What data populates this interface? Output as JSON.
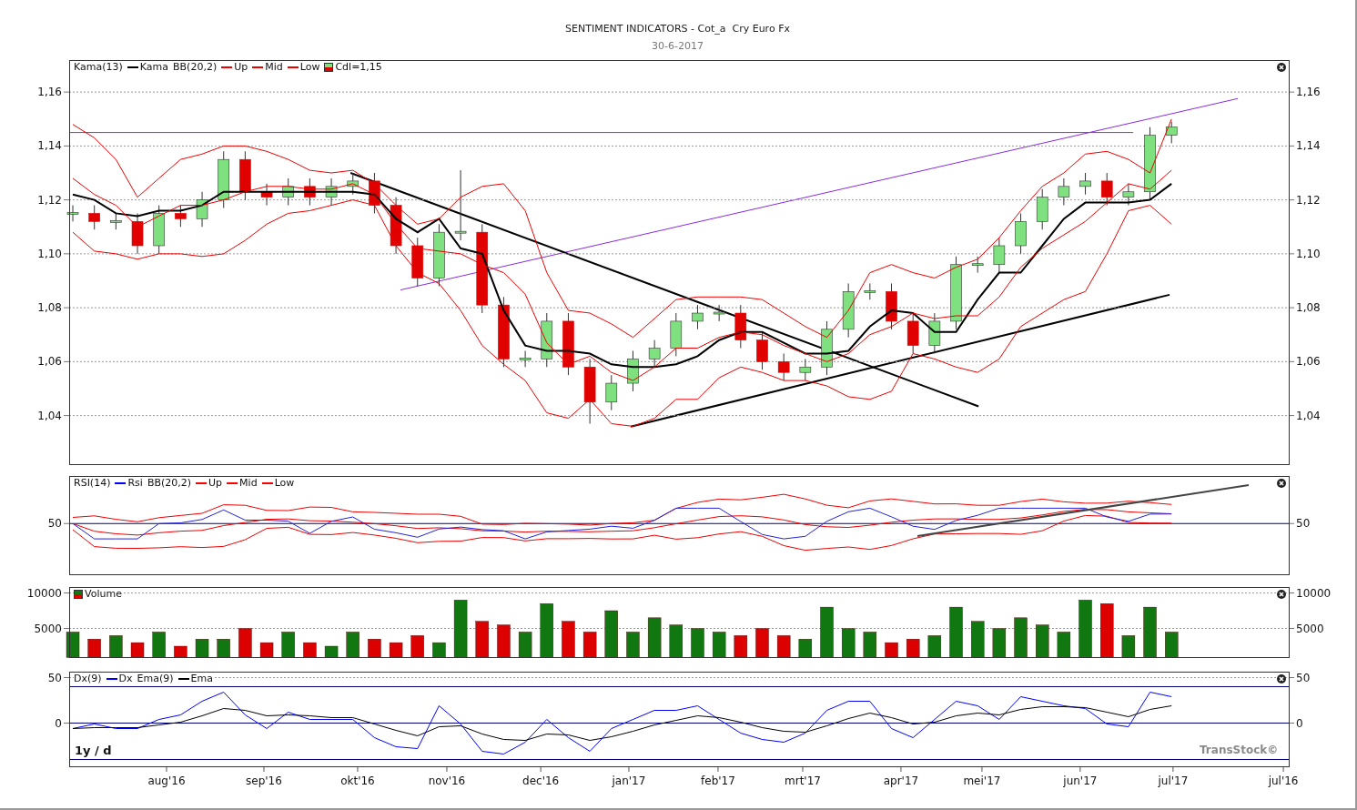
{
  "title": "SENTIMENT INDICATORS - Cot_a  Cry Euro Fx",
  "date": "30-6-2017",
  "panels": [
    {
      "kind": "price",
      "legend": [
        {
          "kind": "text",
          "label": "Kama(13)"
        },
        {
          "kind": "series"
        },
        {
          "kind": "text",
          "label": "BB(20,2)"
        },
        {
          "kind": "series"
        },
        {
          "kind": "series"
        },
        {
          "kind": "series"
        },
        {
          "kind": "swatch",
          "label": "Cdl=1,15"
        }
      ],
      "right_ticks": [
        "1,16",
        "1,14",
        "1,12",
        "1,10",
        "1,08",
        "1,06",
        "1,04"
      ],
      "chart_data": {
        "type": "candlestick",
        "grid": true,
        "categories": [
          null,
          null,
          null,
          null,
          null,
          null,
          null,
          null,
          null,
          null,
          null,
          null,
          null,
          null,
          null,
          null,
          null,
          null,
          null,
          null,
          null,
          null,
          null,
          null,
          null,
          null,
          null,
          null,
          null,
          null,
          null,
          null,
          null,
          null,
          null,
          null,
          null,
          null,
          null,
          null,
          null,
          null,
          null,
          null,
          null,
          null,
          null,
          null,
          null,
          null,
          null,
          null
        ],
        "ylim": [
          1.0218,
          1.1717
        ],
        "yticks": [
          {
            "value": 1.16,
            "label": "1,16"
          },
          {
            "value": 1.14,
            "label": "1,14"
          },
          {
            "value": 1.12,
            "label": "1,12"
          },
          {
            "value": 1.1,
            "label": "1,10"
          },
          {
            "value": 1.08,
            "label": "1,08"
          },
          {
            "value": 1.06,
            "label": "1,06"
          },
          {
            "value": 1.04,
            "label": "1,04"
          }
        ],
        "ohlc": [
          [
            1.115,
            1.118,
            1.112,
            1.115
          ],
          [
            1.115,
            1.118,
            1.109,
            1.112
          ],
          [
            1.112,
            1.115,
            1.109,
            1.112
          ],
          [
            1.112,
            1.115,
            1.1,
            1.103
          ],
          [
            1.103,
            1.118,
            1.1,
            1.115
          ],
          [
            1.115,
            1.118,
            1.11,
            1.113
          ],
          [
            1.113,
            1.123,
            1.11,
            1.12
          ],
          [
            1.12,
            1.138,
            1.117,
            1.135
          ],
          [
            1.135,
            1.138,
            1.12,
            1.123
          ],
          [
            1.123,
            1.126,
            1.118,
            1.121
          ],
          [
            1.121,
            1.128,
            1.118,
            1.125
          ],
          [
            1.125,
            1.128,
            1.118,
            1.121
          ],
          [
            1.121,
            1.128,
            1.118,
            1.125
          ],
          [
            1.125,
            1.13,
            1.122,
            1.127
          ],
          [
            1.127,
            1.13,
            1.115,
            1.118
          ],
          [
            1.118,
            1.121,
            1.1,
            1.103
          ],
          [
            1.103,
            1.106,
            1.088,
            1.091
          ],
          [
            1.091,
            1.111,
            1.088,
            1.108
          ],
          [
            1.108,
            1.131,
            1.105,
            1.108
          ],
          [
            1.108,
            1.111,
            1.078,
            1.081
          ],
          [
            1.081,
            1.084,
            1.058,
            1.061
          ],
          [
            1.061,
            1.064,
            1.058,
            1.061
          ],
          [
            1.061,
            1.078,
            1.058,
            1.075
          ],
          [
            1.075,
            1.078,
            1.055,
            1.058
          ],
          [
            1.058,
            1.061,
            1.037,
            1.045
          ],
          [
            1.045,
            1.055,
            1.042,
            1.052
          ],
          [
            1.052,
            1.064,
            1.049,
            1.061
          ],
          [
            1.061,
            1.068,
            1.058,
            1.065
          ],
          [
            1.065,
            1.078,
            1.062,
            1.075
          ],
          [
            1.075,
            1.081,
            1.072,
            1.078
          ],
          [
            1.078,
            1.081,
            1.075,
            1.078
          ],
          [
            1.078,
            1.081,
            1.065,
            1.068
          ],
          [
            1.068,
            1.071,
            1.057,
            1.06
          ],
          [
            1.06,
            1.063,
            1.053,
            1.056
          ],
          [
            1.056,
            1.061,
            1.053,
            1.058
          ],
          [
            1.058,
            1.075,
            1.055,
            1.072
          ],
          [
            1.072,
            1.089,
            1.069,
            1.086
          ],
          [
            1.086,
            1.089,
            1.083,
            1.086
          ],
          [
            1.086,
            1.089,
            1.072,
            1.075
          ],
          [
            1.075,
            1.078,
            1.063,
            1.066
          ],
          [
            1.066,
            1.078,
            1.063,
            1.075
          ],
          [
            1.075,
            1.099,
            1.072,
            1.096
          ],
          [
            1.096,
            1.099,
            1.093,
            1.096
          ],
          [
            1.096,
            1.106,
            1.093,
            1.103
          ],
          [
            1.103,
            1.115,
            1.1,
            1.112
          ],
          [
            1.112,
            1.124,
            1.109,
            1.121
          ],
          [
            1.121,
            1.128,
            1.118,
            1.125
          ],
          [
            1.125,
            1.13,
            1.122,
            1.127
          ],
          [
            1.127,
            1.13,
            1.118,
            1.121
          ],
          [
            1.121,
            1.126,
            1.118,
            1.123
          ],
          [
            1.123,
            1.147,
            1.12,
            1.144
          ],
          [
            1.144,
            1.149,
            1.141,
            1.147
          ]
        ],
        "series": [
          {
            "name": "Kama",
            "type": "line",
            "color": "#000000",
            "values": [
              1.122,
              1.12,
              1.115,
              1.114,
              1.116,
              1.116,
              1.118,
              1.123,
              1.123,
              1.123,
              1.123,
              1.123,
              1.123,
              1.123,
              1.122,
              1.113,
              1.108,
              1.113,
              1.102,
              1.1,
              1.079,
              1.066,
              1.064,
              1.064,
              1.063,
              1.059,
              1.058,
              1.058,
              1.059,
              1.062,
              1.068,
              1.071,
              1.071,
              1.067,
              1.063,
              1.063,
              1.064,
              1.073,
              1.079,
              1.078,
              1.071,
              1.071,
              1.083,
              1.093,
              1.093,
              1.103,
              1.113,
              1.119,
              1.119,
              1.119,
              1.12,
              1.126
            ]
          },
          {
            "name": "Up",
            "type": "line",
            "color": "#ee0000",
            "values": [
              1.148,
              1.143,
              1.135,
              1.121,
              1.128,
              1.135,
              1.137,
              1.14,
              1.14,
              1.138,
              1.135,
              1.131,
              1.13,
              1.131,
              1.126,
              1.118,
              1.111,
              1.113,
              1.121,
              1.125,
              1.126,
              1.116,
              1.093,
              1.079,
              1.078,
              1.074,
              1.069,
              1.076,
              1.083,
              1.084,
              1.084,
              1.084,
              1.083,
              1.078,
              1.073,
              1.069,
              1.079,
              1.093,
              1.096,
              1.093,
              1.091,
              1.095,
              1.098,
              1.106,
              1.116,
              1.125,
              1.13,
              1.137,
              1.138,
              1.135,
              1.13,
              1.15
            ]
          },
          {
            "name": "Mid",
            "type": "line",
            "color": "#ee0000",
            "values": [
              1.128,
              1.122,
              1.118,
              1.11,
              1.114,
              1.118,
              1.118,
              1.12,
              1.123,
              1.125,
              1.125,
              1.124,
              1.124,
              1.126,
              1.122,
              1.111,
              1.102,
              1.101,
              1.1,
              1.096,
              1.093,
              1.085,
              1.067,
              1.059,
              1.062,
              1.056,
              1.053,
              1.058,
              1.065,
              1.065,
              1.069,
              1.071,
              1.07,
              1.066,
              1.063,
              1.06,
              1.063,
              1.07,
              1.073,
              1.078,
              1.076,
              1.077,
              1.077,
              1.084,
              1.095,
              1.102,
              1.107,
              1.112,
              1.119,
              1.126,
              1.124,
              1.131
            ]
          },
          {
            "name": "Low",
            "type": "line",
            "color": "#ee0000",
            "values": [
              1.108,
              1.101,
              1.1,
              1.098,
              1.1,
              1.1,
              1.099,
              1.1,
              1.105,
              1.111,
              1.115,
              1.116,
              1.118,
              1.12,
              1.118,
              1.103,
              1.093,
              1.089,
              1.079,
              1.066,
              1.059,
              1.053,
              1.041,
              1.039,
              1.046,
              1.037,
              1.036,
              1.039,
              1.046,
              1.046,
              1.054,
              1.058,
              1.056,
              1.053,
              1.053,
              1.051,
              1.047,
              1.046,
              1.049,
              1.063,
              1.061,
              1.058,
              1.056,
              1.061,
              1.073,
              1.078,
              1.083,
              1.086,
              1.1,
              1.116,
              1.118,
              1.111
            ]
          }
        ]
      }
    },
    {
      "kind": "rsi",
      "legend": [
        {
          "kind": "text",
          "label": "RSI(14)"
        },
        {
          "kind": "line",
          "color": "#0000ff",
          "label": "Rsi"
        },
        {
          "kind": "text",
          "label": "BB(20,2)"
        },
        {
          "kind": "line",
          "color": "#ff0000",
          "label": "Up"
        },
        {
          "kind": "line",
          "color": "#ff0000",
          "label": "Mid"
        },
        {
          "kind": "line",
          "color": "#ff0000",
          "label": "Low"
        }
      ],
      "left_label": "50",
      "right_label": "50"
    },
    {
      "kind": "volume",
      "legend": [
        {
          "kind": "series"
        }
      ],
      "right_ticks": [
        "10000",
        "5000"
      ],
      "chart_data": {
        "type": "bar",
        "grid": true,
        "categories": [
          null,
          null,
          null,
          null,
          null,
          null,
          null,
          null,
          null,
          null,
          null,
          null,
          null,
          null,
          null,
          null,
          null,
          null,
          null,
          null,
          null,
          null,
          null,
          null,
          null,
          null,
          null,
          null,
          null,
          null,
          null,
          null,
          null,
          null,
          null,
          null,
          null,
          null,
          null,
          null,
          null,
          null,
          null,
          null,
          null,
          null,
          null,
          null,
          null,
          null,
          null,
          null
        ],
        "ylim": [
          900,
          10770
        ],
        "yticks": [
          {
            "value": 10000,
            "label": "10000"
          },
          {
            "value": 5000,
            "label": "5000"
          }
        ],
        "series": [
          {
            "name": "Volume",
            "values": [
              4500,
              3500,
              4000,
              3000,
              4500,
              2500,
              3500,
              3500,
              5000,
              3000,
              4500,
              3000,
              2500,
              4500,
              3500,
              3000,
              4000,
              3000,
              9000,
              6000,
              5500,
              4500,
              8500,
              6000,
              4500,
              7500,
              4500,
              6500,
              5500,
              5000,
              4500,
              4000,
              5000,
              4000,
              3500,
              8000,
              5000,
              4500,
              3000,
              3500,
              4000,
              8000,
              6000,
              5000,
              6500,
              5500,
              4500,
              9000,
              8500,
              4000,
              8000,
              4500
            ]
          }
        ]
      }
    },
    {
      "kind": "dx",
      "legend": [
        {
          "kind": "text",
          "label": "Dx(9)"
        },
        {
          "kind": "series"
        },
        {
          "kind": "text",
          "label": "Ema(9)"
        },
        {
          "kind": "series"
        }
      ],
      "right_ticks": [
        "50",
        "0"
      ],
      "period": "1y / d",
      "brand": "TransStock©",
      "axis_labels": [
        "aug'16",
        "sep'16",
        "okt'16",
        "nov'16",
        "dec'16",
        "jan'17",
        "feb'17",
        "mrt'17",
        "apr'17",
        "mei'17",
        "jun'17",
        "jul'17",
        "jul'16"
      ],
      "chart_data": {
        "type": "line",
        "grid": true,
        "categories": [
          null,
          null,
          null,
          null,
          null,
          null,
          null,
          null,
          null,
          null,
          null,
          null,
          null,
          null,
          null,
          null,
          null,
          null,
          null,
          null,
          null,
          null,
          null,
          null,
          null,
          null,
          null,
          null,
          null,
          null,
          null,
          null,
          null,
          null,
          null,
          null,
          null,
          null,
          null,
          null,
          null,
          null,
          null,
          null,
          null,
          null,
          null,
          null,
          null,
          null,
          null,
          null
        ],
        "ylim": [
          -48,
          56
        ],
        "yticks": [
          {
            "value": 50,
            "label": "50"
          },
          {
            "value": 0,
            "label": "0"
          }
        ],
        "series": [
          {
            "name": "Dx",
            "color": "#0000ff",
            "values": [
              -6,
              -1,
              -6,
              -6,
              4,
              9,
              24,
              34,
              9,
              -6,
              12,
              4,
              4,
              4,
              -16,
              -26,
              -28,
              19,
              -1,
              -31,
              -34,
              -21,
              4,
              -16,
              -31,
              -6,
              4,
              14,
              14,
              19,
              4,
              -11,
              -18,
              -21,
              -11,
              14,
              24,
              24,
              -6,
              -16,
              4,
              24,
              19,
              4,
              29,
              24,
              19,
              16,
              -1,
              -4,
              34,
              29
            ]
          },
          {
            "name": "Ema",
            "color": "#000000",
            "values": [
              -6,
              -5,
              -5,
              -5,
              -2,
              1,
              8,
              16,
              14,
              8,
              9,
              8,
              6,
              6,
              -1,
              -8,
              -14,
              -4,
              -3,
              -12,
              -18,
              -19,
              -12,
              -13,
              -19,
              -15,
              -9,
              -2,
              3,
              8,
              6,
              1,
              -5,
              -9,
              -10,
              -3,
              5,
              11,
              6,
              -1,
              1,
              8,
              11,
              9,
              15,
              18,
              18,
              17,
              12,
              7,
              15,
              19
            ]
          }
        ]
      }
    }
  ]
}
